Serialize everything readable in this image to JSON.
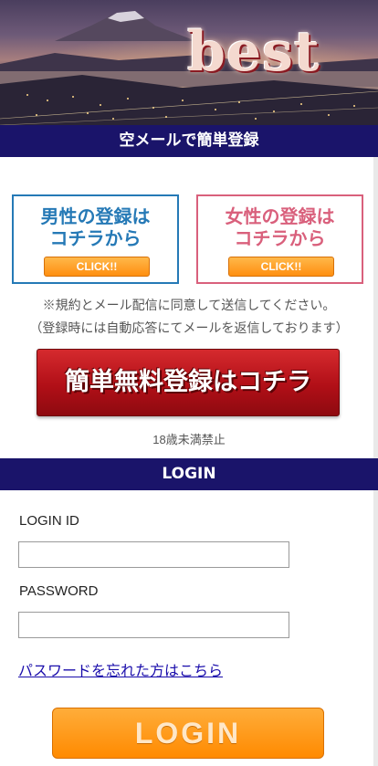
{
  "header": {
    "brand": "best"
  },
  "registration": {
    "section_title": "空メールで簡単登録",
    "male_line1": "男性の登録は",
    "male_line2": "コチラから",
    "female_line1": "女性の登録は",
    "female_line2": "コチラから",
    "click_label": "CLICK!!",
    "notice1": "※規約とメール配信に同意して送信してください。",
    "notice2": "（登録時には自動応答にてメールを返信しております）",
    "register_button": "簡単無料登録はコチラ",
    "age_notice": "18歳未満禁止"
  },
  "login": {
    "section_title": "LOGIN",
    "id_label": "LOGIN ID",
    "id_value": "",
    "password_label": "PASSWORD",
    "password_value": "",
    "forgot_link": "パスワードを忘れた方はこちら",
    "button": "LOGIN"
  },
  "colors": {
    "section_bar": "#1a146a",
    "male_accent": "#2579b6",
    "female_accent": "#d9607c",
    "register_red": "#b10f17",
    "login_orange": "#ff8a00"
  }
}
